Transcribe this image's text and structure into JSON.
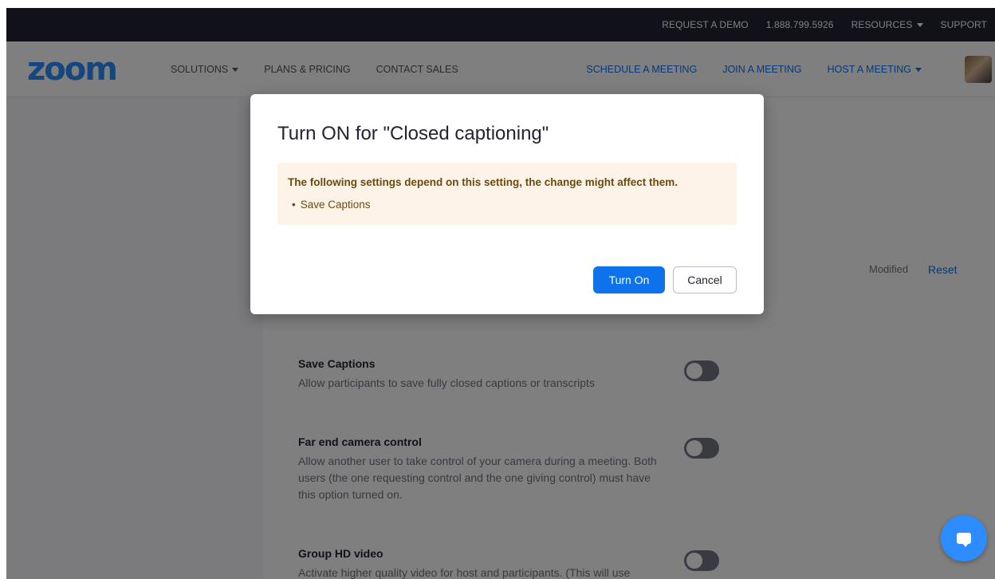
{
  "topbar": {
    "request_demo": "REQUEST A DEMO",
    "phone": "1.888.799.5926",
    "resources": "RESOURCES",
    "support": "SUPPORT"
  },
  "nav": {
    "logo": "zoom",
    "solutions": "SOLUTIONS",
    "plans": "PLANS & PRICING",
    "contact_sales": "CONTACT SALES",
    "schedule": "SCHEDULE A MEETING",
    "join": "JOIN A MEETING",
    "host": "HOST A MEETING"
  },
  "settings": {
    "modified": "Modified",
    "reset": "Reset",
    "items": [
      {
        "title": "Save Captions",
        "desc": "Allow participants to save fully closed captions or transcripts",
        "enabled": false
      },
      {
        "title": "Far end camera control",
        "desc": "Allow another user to take control of your camera during a meeting. Both users (the one requesting control and the one giving control) must have this option turned on.",
        "enabled": false
      },
      {
        "title": "Group HD video",
        "desc": "Activate higher quality video for host and participants. (This will use",
        "enabled": false
      }
    ]
  },
  "modal": {
    "title": "Turn ON for \"Closed captioning\"",
    "warning": "The following settings depend on this setting, the change might affect them.",
    "dependent_items": [
      "Save Captions"
    ],
    "confirm_label": "Turn On",
    "cancel_label": "Cancel"
  },
  "colors": {
    "brand": "#2D8CFF",
    "link": "#0E72ED",
    "topbar": "#232333",
    "warning_bg": "#fdf3e8",
    "warning_text": "#6b4a10"
  },
  "icons": {
    "chat": "chat-bubble-icon",
    "caret": "caret-down-icon",
    "avatar": "user-avatar"
  }
}
